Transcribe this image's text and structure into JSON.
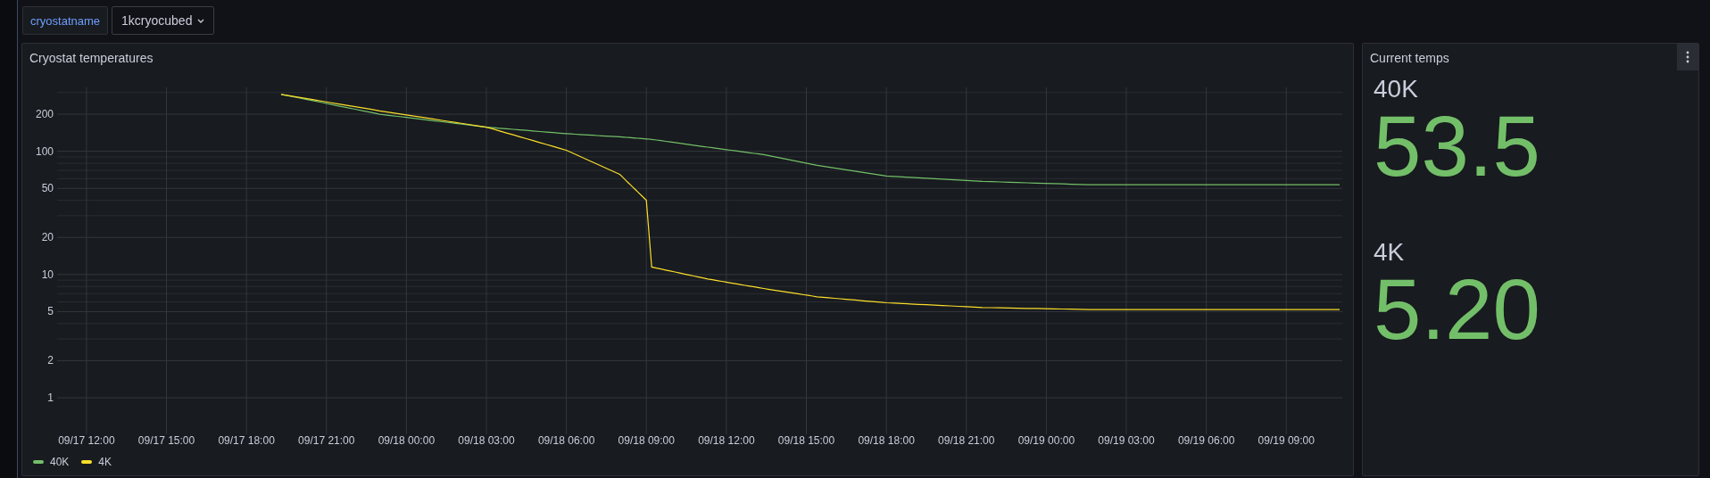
{
  "variables": [
    {
      "label": "cryostatname",
      "value": "1kcryocubed"
    }
  ],
  "panels": [
    {
      "kind": "timeseries",
      "title": "Cryostat temperatures",
      "chart": {
        "kind": "line",
        "y_axis_labels": [
          "200",
          "100",
          "50",
          "20",
          "10",
          "5",
          "2",
          "1"
        ],
        "x_axis_labels": [
          "09/17 12:00",
          "09/17 15:00",
          "09/17 18:00",
          "09/17 21:00",
          "09/18 00:00",
          "09/18 03:00",
          "09/18 06:00",
          "09/18 09:00",
          "09/18 12:00",
          "09/18 15:00",
          "09/18 18:00",
          "09/18 21:00",
          "09/19 00:00",
          "09/19 03:00",
          "09/19 06:00",
          "09/19 09:00"
        ],
        "legend": [
          {
            "name": "40K",
            "color": "#73bf69"
          },
          {
            "name": "4K",
            "color": "#fade2a"
          }
        ]
      }
    },
    {
      "kind": "stat",
      "title": "Current temps",
      "stats": [
        {
          "name": "40K",
          "value": "53.5",
          "color": "#73bf69"
        },
        {
          "name": "4K",
          "value": "5.20",
          "color": "#73bf69"
        }
      ]
    }
  ]
}
